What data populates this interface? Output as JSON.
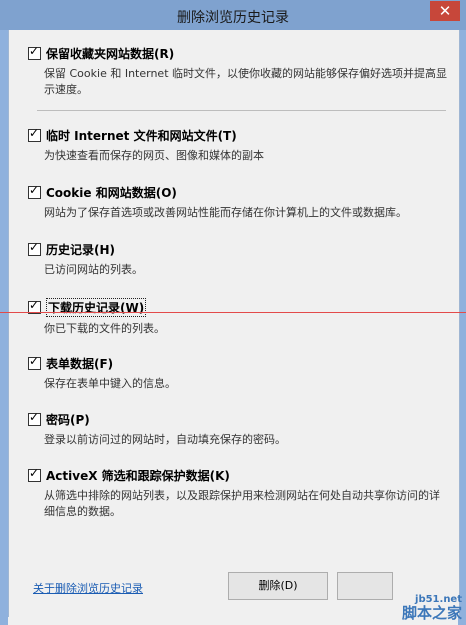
{
  "window": {
    "title": "删除浏览历史记录",
    "close_glyph": "✕"
  },
  "items": [
    {
      "label": "保留收藏夹网站数据(R)",
      "desc": "保留 Cookie 和 Internet 临时文件，以使你收藏的网站能够保存偏好选项并提高显示速度。",
      "checked": true
    },
    {
      "label": "临时 Internet 文件和网站文件(T)",
      "desc": "为快速查看而保存的网页、图像和媒体的副本",
      "checked": true
    },
    {
      "label": "Cookie 和网站数据(O)",
      "desc": "网站为了保存首选项或改善网站性能而存储在你计算机上的文件或数据库。",
      "checked": true
    },
    {
      "label": "历史记录(H)",
      "desc": "已访问网站的列表。",
      "checked": true
    },
    {
      "label": "下载历史记录(W)",
      "desc": "你已下载的文件的列表。",
      "checked": true
    },
    {
      "label": "表单数据(F)",
      "desc": "保存在表单中键入的信息。",
      "checked": true
    },
    {
      "label": "密码(P)",
      "desc": "登录以前访问过的网站时，自动填充保存的密码。",
      "checked": true
    },
    {
      "label": "ActiveX 筛选和跟踪保护数据(K)",
      "desc": "从筛选中排除的网站列表，以及跟踪保护用来检测网站在何处自动共享你访问的详细信息的数据。",
      "checked": true
    }
  ],
  "footer": {
    "link": "关于删除浏览历史记录",
    "delete_button": "删除(D)",
    "cancel_button": ""
  },
  "watermark": {
    "top": "jb51.net",
    "bottom": "脚本之家"
  },
  "colors": {
    "titlebar": "#7fa2cf",
    "close": "#c7473a",
    "link": "#1a5cb3",
    "red_line": "#e34a4a"
  }
}
